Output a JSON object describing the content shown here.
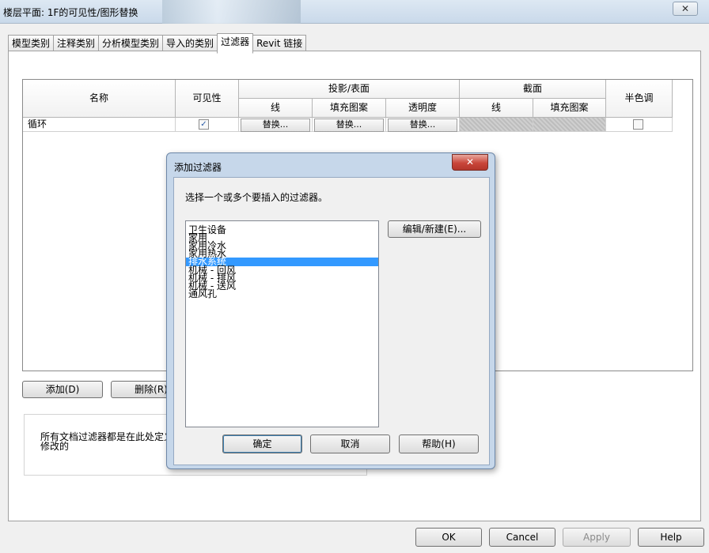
{
  "window": {
    "title": "楼层平面: 1F的可见性/图形替换",
    "close_glyph": "✕"
  },
  "tabs": [
    "模型类别",
    "注释类别",
    "分析模型类别",
    "导入的类别",
    "过滤器",
    "Revit 链接"
  ],
  "active_tab": 4,
  "table": {
    "headers": {
      "name": "名称",
      "visibility": "可见性",
      "projection_group": "投影/表面",
      "proj_line": "线",
      "proj_fill": "填充图案",
      "proj_transparency": "透明度",
      "cut_group": "截面",
      "cut_line": "线",
      "cut_fill": "填充图案",
      "halftone": "半色调"
    },
    "rows": [
      {
        "name": "循环",
        "visible_mark": "✓",
        "override_line": "替换...",
        "override_fill": "替换...",
        "override_transparency": "替换..."
      }
    ]
  },
  "buttons": {
    "add": "添加(D)",
    "delete": "删除(R)"
  },
  "info_text": "所有文档过滤器都是在此处定义和修改的",
  "footer": {
    "ok": "OK",
    "cancel": "Cancel",
    "apply": "Apply",
    "help": "Help"
  },
  "dialog": {
    "title": "添加过滤器",
    "close_glyph": "✕",
    "prompt": "选择一个或多个要插入的过滤器。",
    "items": [
      "卫生设备",
      "家用",
      "家用冷水",
      "家用热水",
      "排水系统",
      "机械 - 回风",
      "机械 - 排风",
      "机械 - 送风",
      "通风孔"
    ],
    "selected_index": 4,
    "edit_new": "编辑/新建(E)...",
    "ok": "确定",
    "cancel": "取消",
    "help": "帮助(H)"
  },
  "colors": {
    "selection": "#3399ff",
    "dialog_frame": "#c6d7ea",
    "close_red": "#c9463a"
  }
}
